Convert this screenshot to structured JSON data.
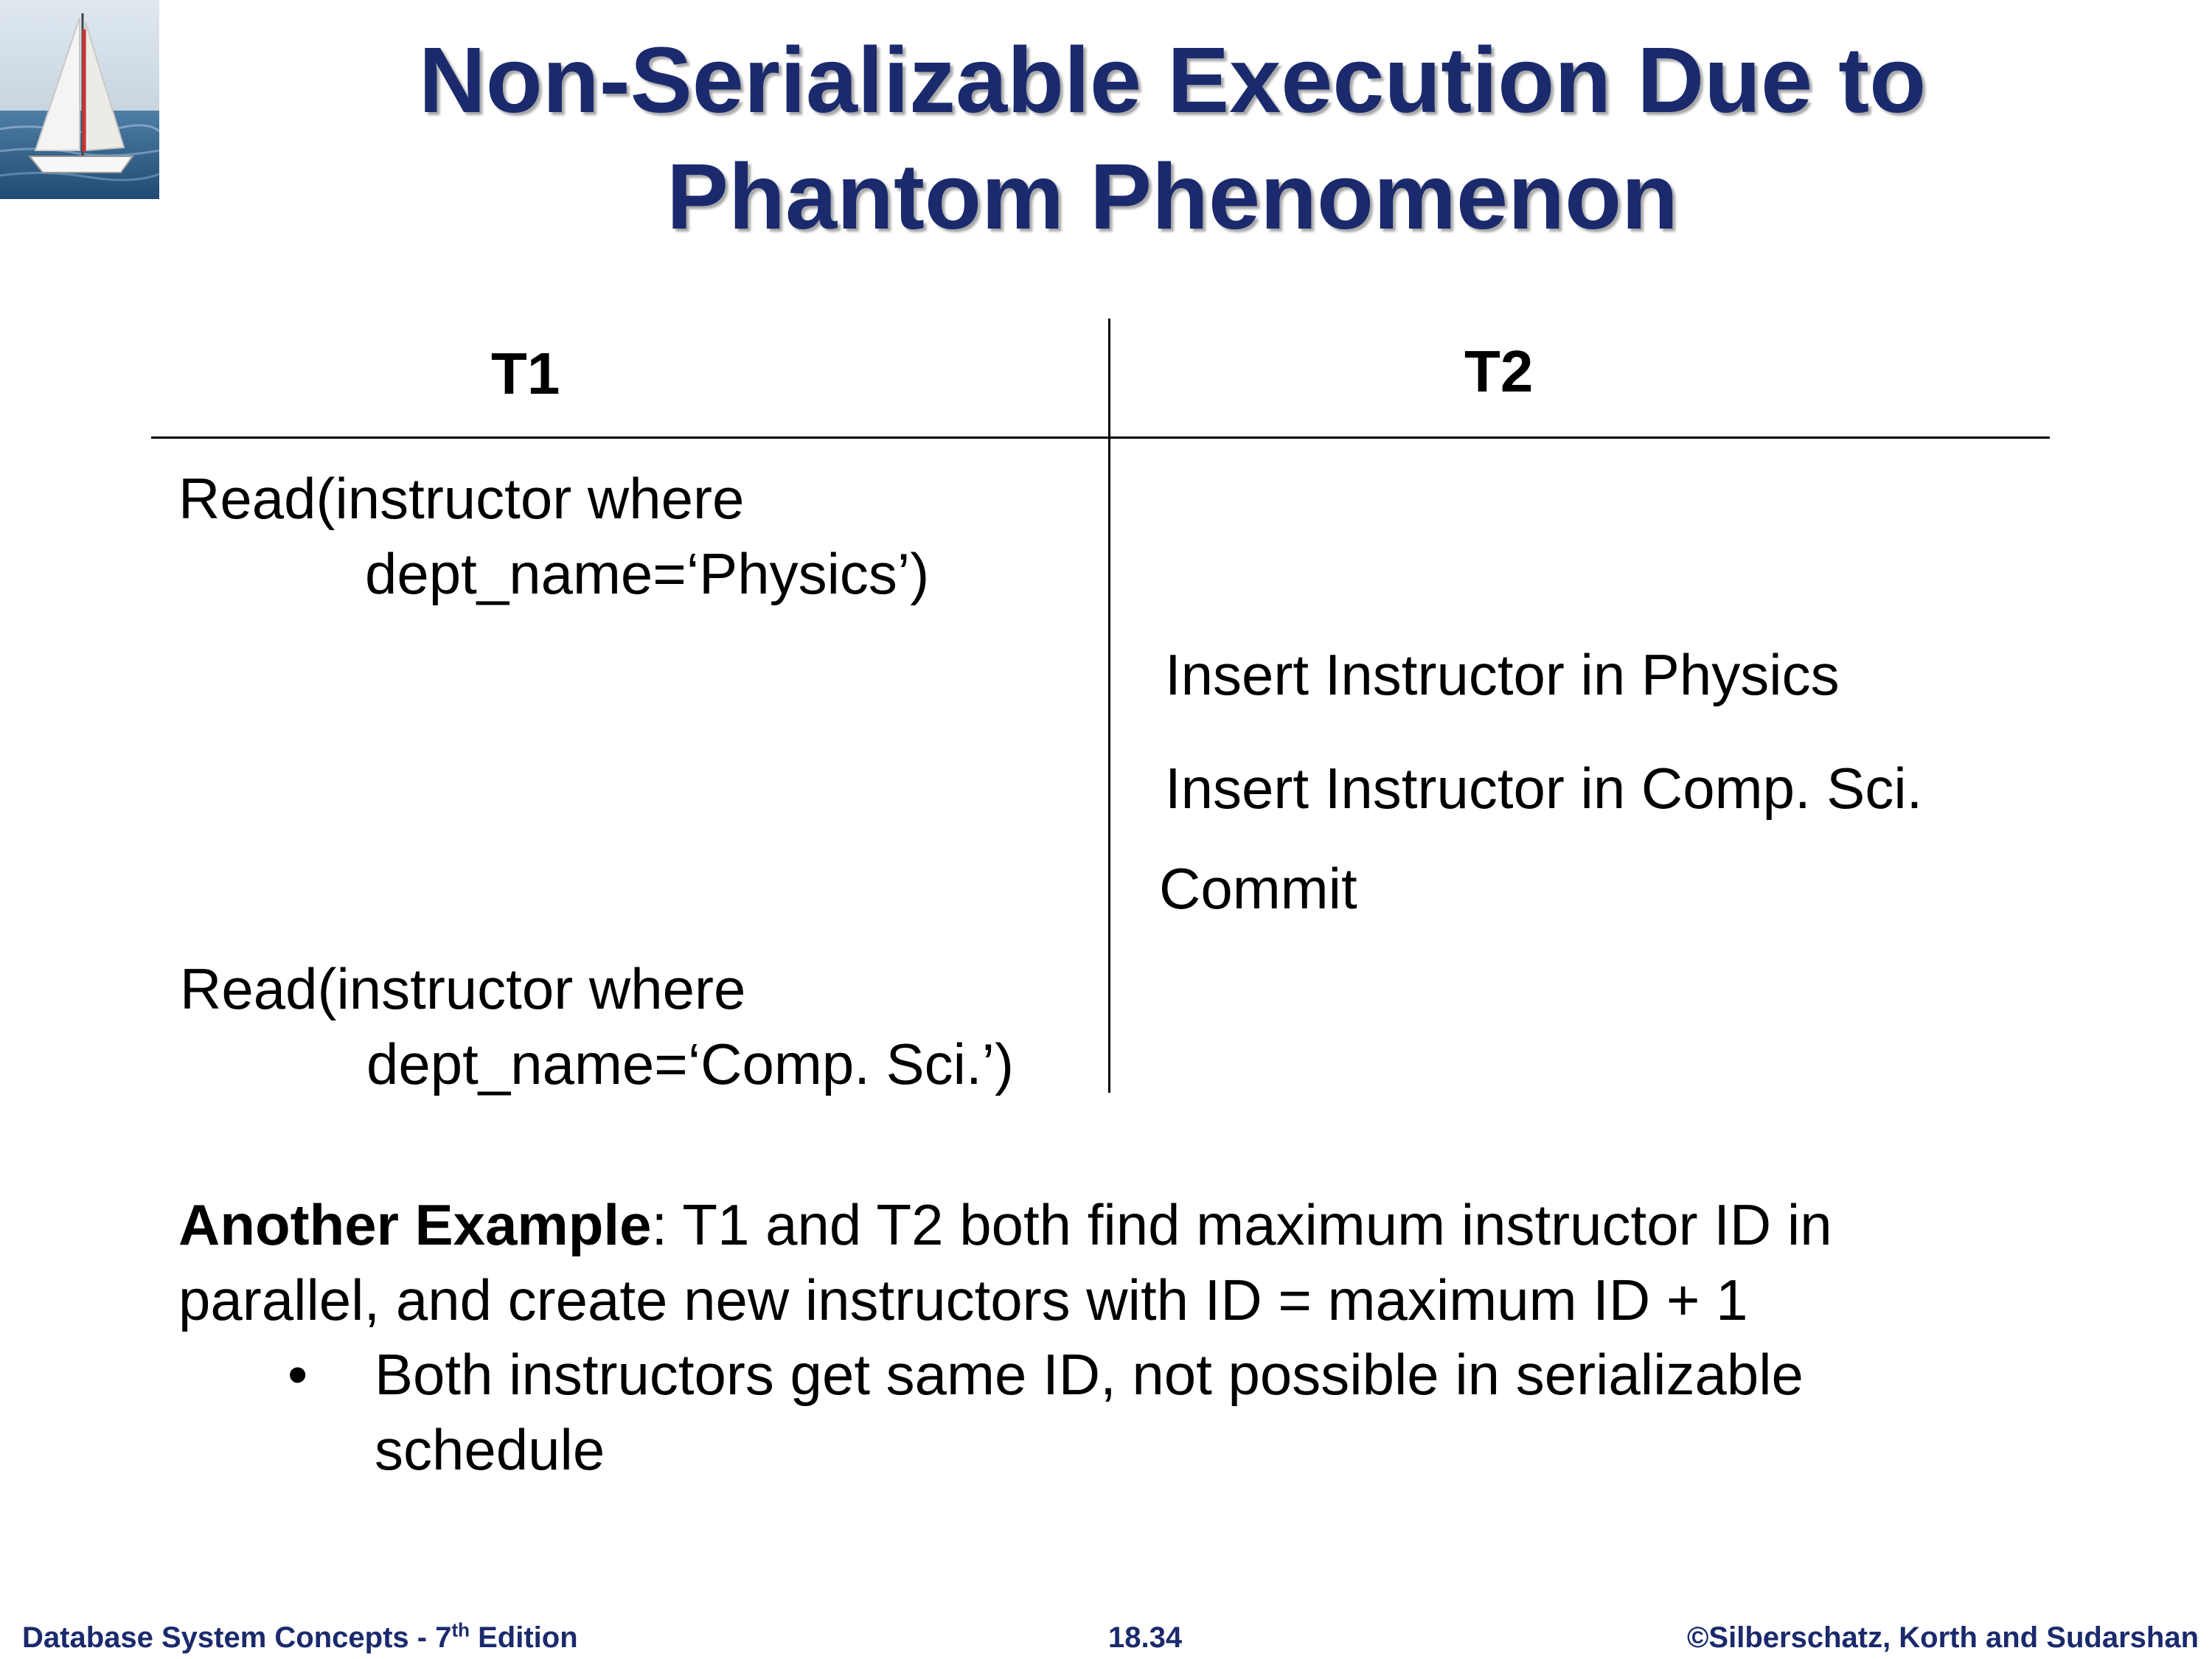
{
  "title": {
    "line1": "Non-Serializable Execution Due to",
    "line2": "Phantom Phenomenon"
  },
  "table": {
    "headers": [
      "T1",
      "T2"
    ],
    "t1_read1": {
      "line1": "Read(instructor where",
      "line2": "dept_name=‘Physics’)"
    },
    "t2_insert1": "Insert Instructor in Physics",
    "t2_insert2": "Insert Instructor in Comp. Sci.",
    "t2_commit": "Commit",
    "t1_read2": {
      "line1": "Read(instructor where",
      "line2": "dept_name=‘Comp. Sci.’)"
    }
  },
  "example": {
    "label": "Another Example",
    "line1_rest": ":  T1 and T2 both find maximum instructor ID in",
    "line2": "parallel, and create new instructors with ID = maximum ID + 1",
    "bullet_symbol": "•",
    "bullet_line1": "Both instructors get same ID, not possible in serializable",
    "bullet_line2": "schedule"
  },
  "footer": {
    "book_prefix": "Database System Concepts - 7",
    "book_sup": "th",
    "book_suffix": " Edition",
    "page": "18.34",
    "copyright": "©Silberschatz, Korth and Sudarshan"
  },
  "colors": {
    "title": "#1a2a6c",
    "footer": "#1a2a6c"
  },
  "logo_icon": "sailboat-icon"
}
